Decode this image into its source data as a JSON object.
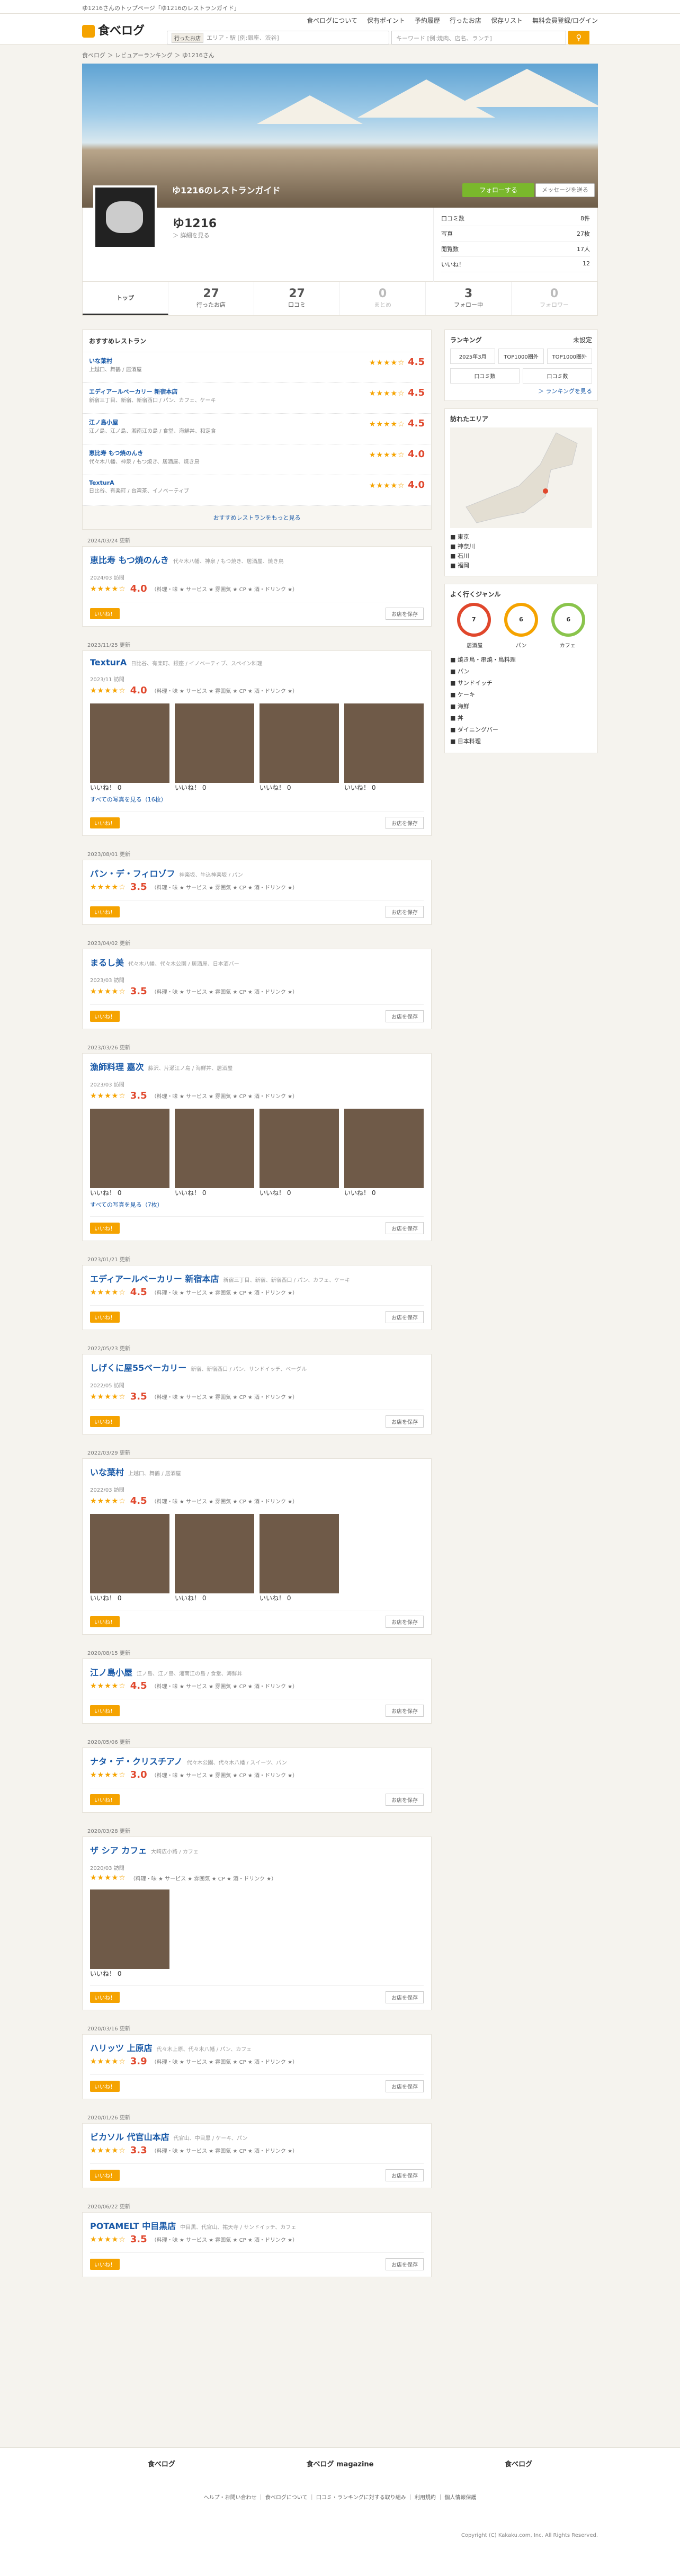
{
  "topbar": {
    "text": "ゆ1216さんのトップページ「ゆ1216のレストランガイド」"
  },
  "header": {
    "logo": "食べログ",
    "nav": [
      "食べログについて",
      "保有ポイント",
      "予約履歴",
      "行ったお店",
      "保存リスト",
      "無料会員登録/ログイン"
    ],
    "search_visited": "行ったお店",
    "search_ph": "エリア・駅 [例:銀座、渋谷]",
    "search_ph2": "キーワード [例:焼肉、店名、ランチ]"
  },
  "crumbs": "食べログ ＞ レビュアーランキング ＞ ゆ1216さん",
  "hero": {
    "title": "ゆ1216のレストランガイド",
    "follow": "フォローする",
    "message": "メッセージを送る"
  },
  "profile": {
    "name": "ゆ1216",
    "detail": "＞ 詳細を見る",
    "stats": [
      {
        "k": "口コミ数",
        "v": "8件"
      },
      {
        "k": "写真",
        "v": "27枚"
      },
      {
        "k": "閲覧数",
        "v": "17人"
      },
      {
        "k": "いいね！",
        "v": "12"
      }
    ]
  },
  "tabs": [
    {
      "l": "トップ"
    },
    {
      "n": "27",
      "l": "行ったお店"
    },
    {
      "n": "27",
      "l": "口コミ"
    },
    {
      "n": "0",
      "l": "まとめ"
    },
    {
      "n": "3",
      "l": "フォロー中"
    },
    {
      "n": "0",
      "l": "フォロワー"
    }
  ],
  "rec": {
    "title": "おすすめレストラン",
    "items": [
      {
        "n": "いな葉村",
        "g": "上越口、舞鶴 / 居酒屋",
        "s": "4.5"
      },
      {
        "n": "エディアールベーカリー 新宿本店",
        "g": "新宿三丁目、新宿、新宿西口 / パン、カフェ、ケーキ",
        "s": "4.5"
      },
      {
        "n": "江ノ島小屋",
        "g": "江ノ島、江ノ島、湘南江の島 / 食堂、海鮮丼、和定食",
        "s": "4.5"
      },
      {
        "n": "恵比寿 もつ焼のんき",
        "g": "代々木八幡、神泉 / もつ焼き、居酒屋、焼き鳥",
        "s": "4.0"
      },
      {
        "n": "TexturA",
        "g": "日比谷、有楽町 / 台湾茶、イノベーティブ",
        "s": "4.0"
      }
    ],
    "more": "おすすめレストランをもっと見る"
  },
  "posts": [
    {
      "date": "2024/03/24 更新",
      "name": "恵比寿 もつ焼のんき",
      "loc": "代々木八幡、神泉 / もつ焼き、居酒屋、焼き鳥",
      "visit": "2024/03 訪問",
      "score": "4.0",
      "photos": 0
    },
    {
      "date": "2023/11/25 更新",
      "name": "TexturA",
      "loc": "日比谷、有楽町、銀座 / イノベーティブ、スペイン料理",
      "visit": "2023/11 訪問",
      "score": "4.0",
      "photos": 4,
      "all": "すべての写真を見る（16枚）"
    },
    {
      "date": "2023/08/01 更新",
      "name": "パン・デ・フィロゾフ",
      "loc": "神楽坂、牛込神楽坂 / パン",
      "visit": "",
      "score": "3.5",
      "photos": 0
    },
    {
      "date": "2023/04/02 更新",
      "name": "まるし美",
      "loc": "代々木八幡、代々木公園 / 居酒屋、日本酒バー",
      "visit": "2023/03 訪問",
      "score": "3.5",
      "photos": 0
    },
    {
      "date": "2023/03/26 更新",
      "name": "漁師料理 嘉次",
      "loc": "藤沢、片瀬江ノ島 / 海鮮丼、居酒屋",
      "visit": "2023/03 訪問",
      "score": "3.5",
      "photos": 4,
      "all": "すべての写真を見る（7枚）"
    },
    {
      "date": "2023/01/21 更新",
      "name": "エディアールベーカリー 新宿本店",
      "loc": "新宿三丁目、新宿、新宿西口 / パン、カフェ、ケーキ",
      "visit": "",
      "score": "4.5",
      "photos": 0
    },
    {
      "date": "2022/05/23 更新",
      "name": "しげくに屋55ベーカリー",
      "loc": "新宿、新宿西口 / パン、サンドイッチ、ベーグル",
      "visit": "2022/05 訪問",
      "score": "3.5",
      "photos": 0
    },
    {
      "date": "2022/03/29 更新",
      "name": "いな葉村",
      "loc": "上越口、舞鶴 / 居酒屋",
      "visit": "2022/03 訪問",
      "score": "4.5",
      "photos": 3
    },
    {
      "date": "2020/08/15 更新",
      "name": "江ノ島小屋",
      "loc": "江ノ島、江ノ島、湘南江の島 / 食堂、海鮮丼",
      "visit": "",
      "score": "4.5",
      "photos": 0
    },
    {
      "date": "2020/05/06 更新",
      "name": "ナタ・デ・クリスチアノ",
      "loc": "代々木公園、代々木八幡 / スイーツ、パン",
      "visit": "",
      "score": "3.0",
      "photos": 0
    },
    {
      "date": "2020/03/28 更新",
      "name": "ザ シア カフェ",
      "loc": "大崎広小路 / カフェ",
      "visit": "2020/03 訪問",
      "score": "",
      "photos": 1
    },
    {
      "date": "2020/03/16 更新",
      "name": "ハリッツ 上原店",
      "loc": "代々木上原、代々木八幡 / パン、カフェ",
      "visit": "",
      "score": "3.9",
      "photos": 0
    },
    {
      "date": "2020/01/26 更新",
      "name": "ビカソル 代官山本店",
      "loc": "代官山、中目黒 / ケーキ、パン",
      "visit": "",
      "score": "3.3",
      "photos": 0
    },
    {
      "date": "2020/06/22 更新",
      "name": "POTAMELT 中目黒店",
      "loc": "中目黒、代官山、祐天寺 / サンドイッチ、カフェ",
      "visit": "",
      "score": "3.5",
      "photos": 0
    }
  ],
  "ui": {
    "like": "いいね！",
    "save": "お店を保存",
    "sub": "（料理・味 ★ サービス ★ 雰囲気 ★ CP ★ 酒・ドリンク ★）",
    "photo_cap": "いいね！ 0",
    "edit": "詳細"
  },
  "side": {
    "ranking": "ランキング",
    "ranking_sub": "未設定",
    "r_month": "2025年3月",
    "r1": "TOP1000圏外",
    "r2": "TOP1000圏外",
    "r_all1": "口コミ数",
    "r_all2": "口コミ数",
    "r_more": "＞ ランキングを見る",
    "area": "訪れたエリア",
    "areas": [
      "東京",
      "神奈川",
      "石川",
      "福岡"
    ],
    "genre": "よく行くジャンル",
    "g1": "7",
    "g2": "6",
    "g3": "6",
    "genres": [
      "居酒屋",
      "パン",
      "カフェ"
    ],
    "glist": [
      "焼き鳥・串焼・鳥料理",
      "パン",
      "サンドイッチ",
      "ケーキ",
      "海鮮",
      "丼",
      "ダイニングバー",
      "日本料理"
    ]
  },
  "footer": {
    "apps": [
      "食べログ",
      "食べログ magazine",
      "食べログ"
    ],
    "links": "ヘルプ・お問い合わせ ｜ 食べログについて ｜ 口コミ・ランキングに対する取り組み ｜ 利用規約 ｜ 個人情報保護",
    "copy": "Copyright (C) Kakaku.com, Inc. All Rights Reserved."
  }
}
